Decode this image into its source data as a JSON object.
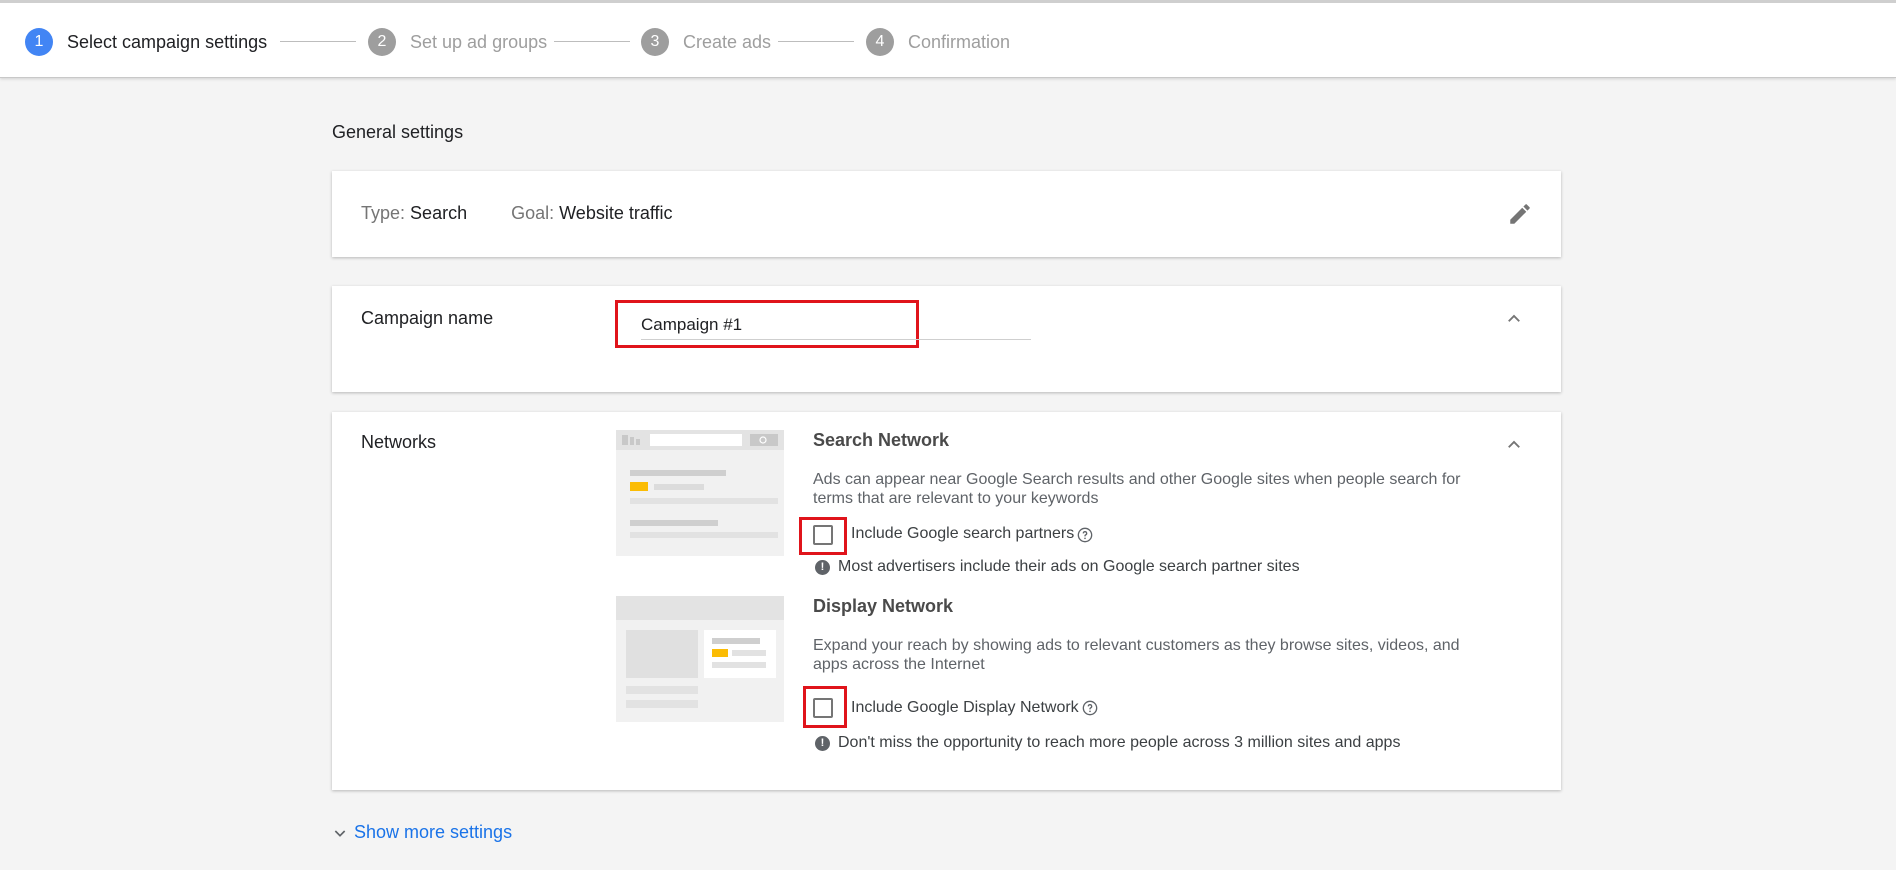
{
  "stepper": {
    "steps": [
      {
        "number": "1",
        "label": "Select campaign settings"
      },
      {
        "number": "2",
        "label": "Set up ad groups"
      },
      {
        "number": "3",
        "label": "Create ads"
      },
      {
        "number": "4",
        "label": "Confirmation"
      }
    ],
    "active_step": 1
  },
  "general_settings": {
    "title": "General settings",
    "type_label": "Type:",
    "type_value": "Search",
    "goal_label": "Goal:",
    "goal_value": "Website traffic"
  },
  "campaign_name": {
    "label": "Campaign name",
    "value": "Campaign #1"
  },
  "networks": {
    "label": "Networks",
    "search": {
      "title": "Search Network",
      "description": "Ads can appear near Google Search results and other Google sites when people search for terms that are relevant to your keywords",
      "checkbox_label": "Include Google search partners",
      "checked": false,
      "info": "Most advertisers include their ads on Google search partner sites"
    },
    "display": {
      "title": "Display Network",
      "description": "Expand your reach by showing ads to relevant customers as they browse sites, videos, and apps across the Internet",
      "checkbox_label": "Include Google Display Network",
      "checked": false,
      "info": "Don't miss the opportunity to reach more people across 3 million sites and apps"
    }
  },
  "show_more": {
    "label": "Show more settings"
  },
  "colors": {
    "accent_blue": "#4285f4",
    "link_blue": "#1a73e8",
    "highlight_red": "#e0141b",
    "illustration_yellow": "#fbbc04"
  }
}
